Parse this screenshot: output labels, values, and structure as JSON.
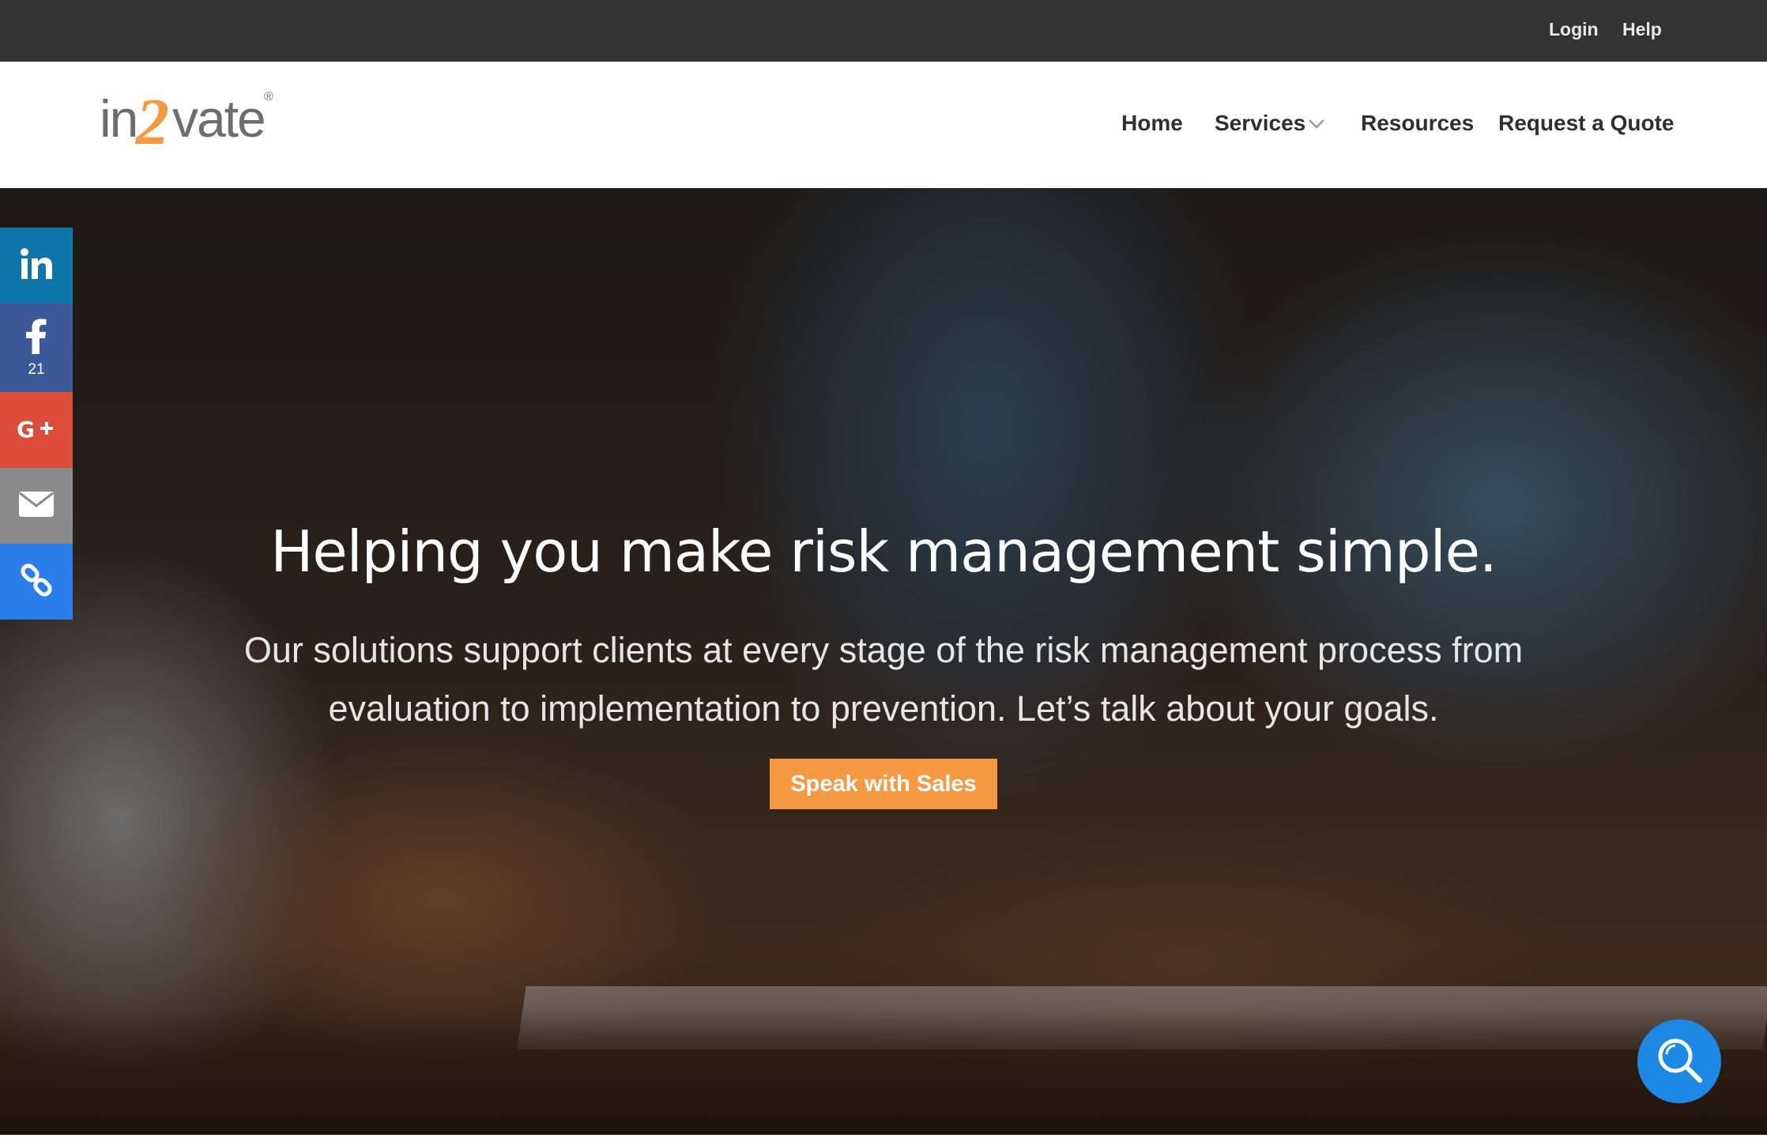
{
  "topbar": {
    "login": "Login",
    "help": "Help"
  },
  "logo": {
    "part1": "in",
    "part2": "2",
    "part3": "vate",
    "registered": "®"
  },
  "nav": {
    "home": "Home",
    "services": "Services",
    "resources": "Resources",
    "quote": "Request a Quote"
  },
  "hero": {
    "title": "Helping you make risk management simple.",
    "subtitle": "Our solutions support clients at every stage of the risk management process from evaluation to implementation to prevention. Let’s talk about your goals.",
    "cta": "Speak with Sales"
  },
  "social": {
    "items": [
      {
        "icon": "linkedin-icon",
        "color": "#0e76a8"
      },
      {
        "icon": "facebook-icon",
        "color": "#3b5998",
        "count": "21"
      },
      {
        "icon": "google-plus-icon",
        "color": "#dd4b39"
      },
      {
        "icon": "email-icon",
        "color": "#8a8a8a"
      },
      {
        "icon": "link-icon",
        "color": "#2b7de9"
      }
    ]
  },
  "colors": {
    "accent": "#f59a42",
    "topbar": "#333333",
    "fab": "#1e88e5"
  },
  "fab": {
    "icon": "search-icon"
  }
}
